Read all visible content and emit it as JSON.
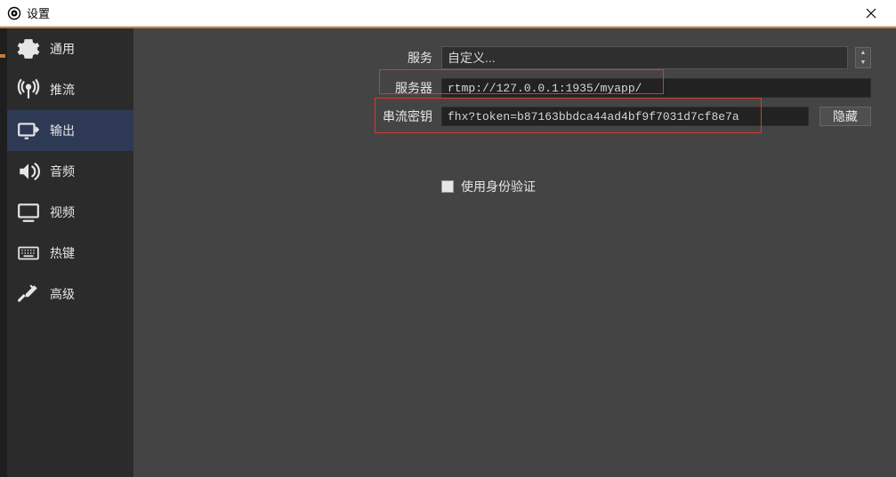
{
  "window": {
    "title": "设置"
  },
  "sidebar": {
    "items": [
      {
        "label": "通用"
      },
      {
        "label": "推流"
      },
      {
        "label": "输出"
      },
      {
        "label": "音频"
      },
      {
        "label": "视频"
      },
      {
        "label": "热键"
      },
      {
        "label": "高级"
      }
    ]
  },
  "form": {
    "service_label": "服务",
    "service_value": "自定义...",
    "server_label": "服务器",
    "server_value": "rtmp://127.0.0.1:1935/myapp/",
    "stream_key_label": "串流密钥",
    "stream_key_value": "fhx?token=b87163bbdca44ad4bf9f7031d7cf8e7a",
    "hide_button": "隐藏",
    "use_auth_label": "使用身份验证"
  }
}
